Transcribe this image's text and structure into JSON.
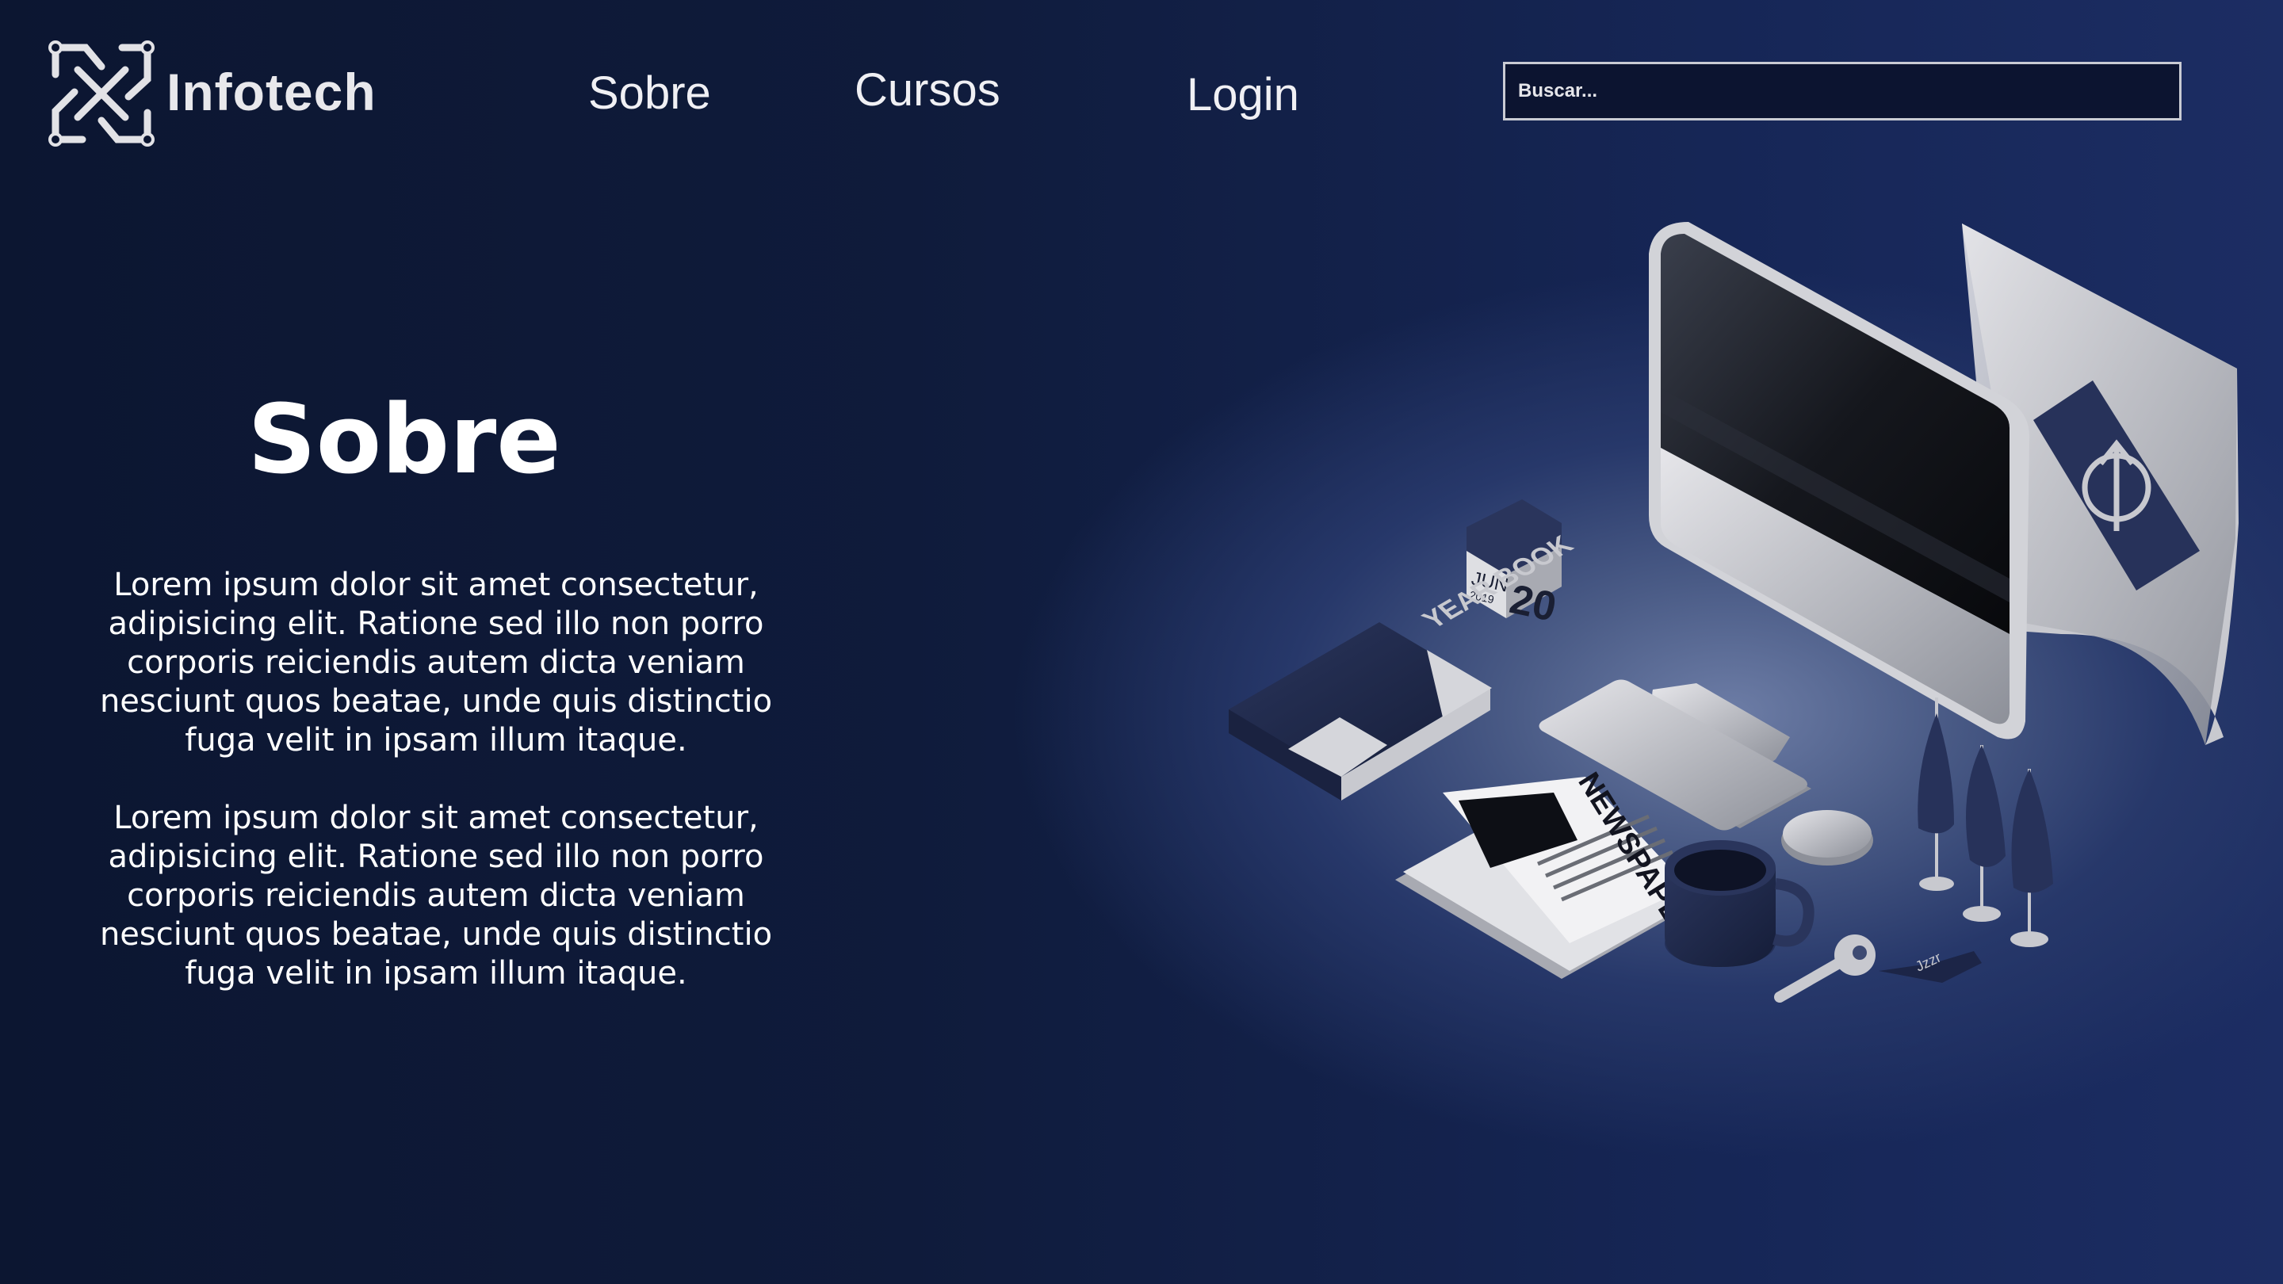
{
  "brand": {
    "name": "Infotech",
    "logo_icon": "circuit-logo-icon"
  },
  "nav": {
    "sobre": "Sobre",
    "cursos": "Cursos",
    "login": "Login"
  },
  "search": {
    "placeholder": "Buscar..."
  },
  "main": {
    "title": "Sobre",
    "paragraphs": [
      "Lorem ipsum dolor sit amet consectetur, adipisicing elit. Ratione sed illo non porro corporis reiciendis autem dicta veniam nesciunt quos beatae, unde quis distinctio fuga velit in ipsam illum itaque.",
      "Lorem ipsum dolor sit amet consectetur, adipisicing elit. Ratione sed illo non porro corporis reiciendis autem dicta veniam nesciunt quos beatae, unde quis distinctio fuga velit in ipsam illum itaque."
    ]
  },
  "illustration": {
    "calendar_month": "JUN",
    "calendar_year": "2019",
    "calendar_day": "20",
    "book_text": "YEAR BOOK",
    "newspaper_text": "NEWSPAPE",
    "key_tag_text": "Jzzr"
  },
  "colors": {
    "accent": "#1c2d63",
    "background": "#0c1631",
    "text": "#ffffff"
  }
}
